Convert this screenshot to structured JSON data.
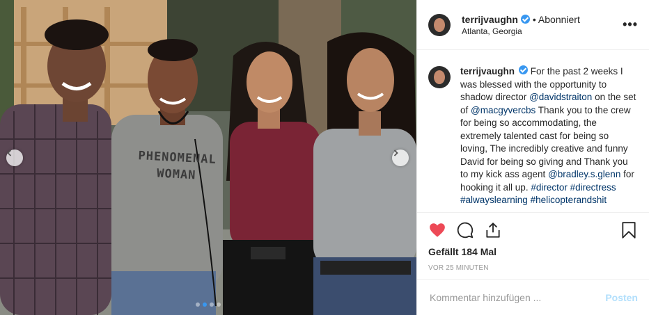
{
  "post": {
    "username": "terrijvaughn",
    "follow_status": "• Abonniert",
    "location": "Atlanta, Georgia",
    "more_label": "•••",
    "shirt_text_line1": "PHENOMENAL",
    "shirt_text_line2": "WOMAN",
    "caption": {
      "username": "terrijvaughn",
      "part1": " For the past 2 weeks I was blessed with the opportunity to shadow director ",
      "mention1": "@davidstraiton",
      "part2": " on the set of ",
      "mention2": "@macgyvercbs",
      "part3": " Thank you to the crew for being so accommodating, the extremely talented cast for being so loving, The incredibly creative and funny David for being so giving and Thank you to my kick ass agent ",
      "mention3": "@bradley.s.glenn",
      "part4": " for hooking it all up. ",
      "tag1": "#director",
      "tag2": "#directress",
      "tag3": "#alwayslearning",
      "tag4": "#helicopterandshit"
    },
    "likes": "Gefällt 184 Mal",
    "time": "VOR 25 MINUTEN",
    "comment_placeholder": "Kommentar hinzufügen ...",
    "post_button": "Posten",
    "carousel": {
      "count": 4,
      "active_index": 1
    }
  },
  "colors": {
    "like": "#ed4956",
    "link": "#003569",
    "verified": "#3897f0",
    "post_disabled": "#b2dffc"
  }
}
